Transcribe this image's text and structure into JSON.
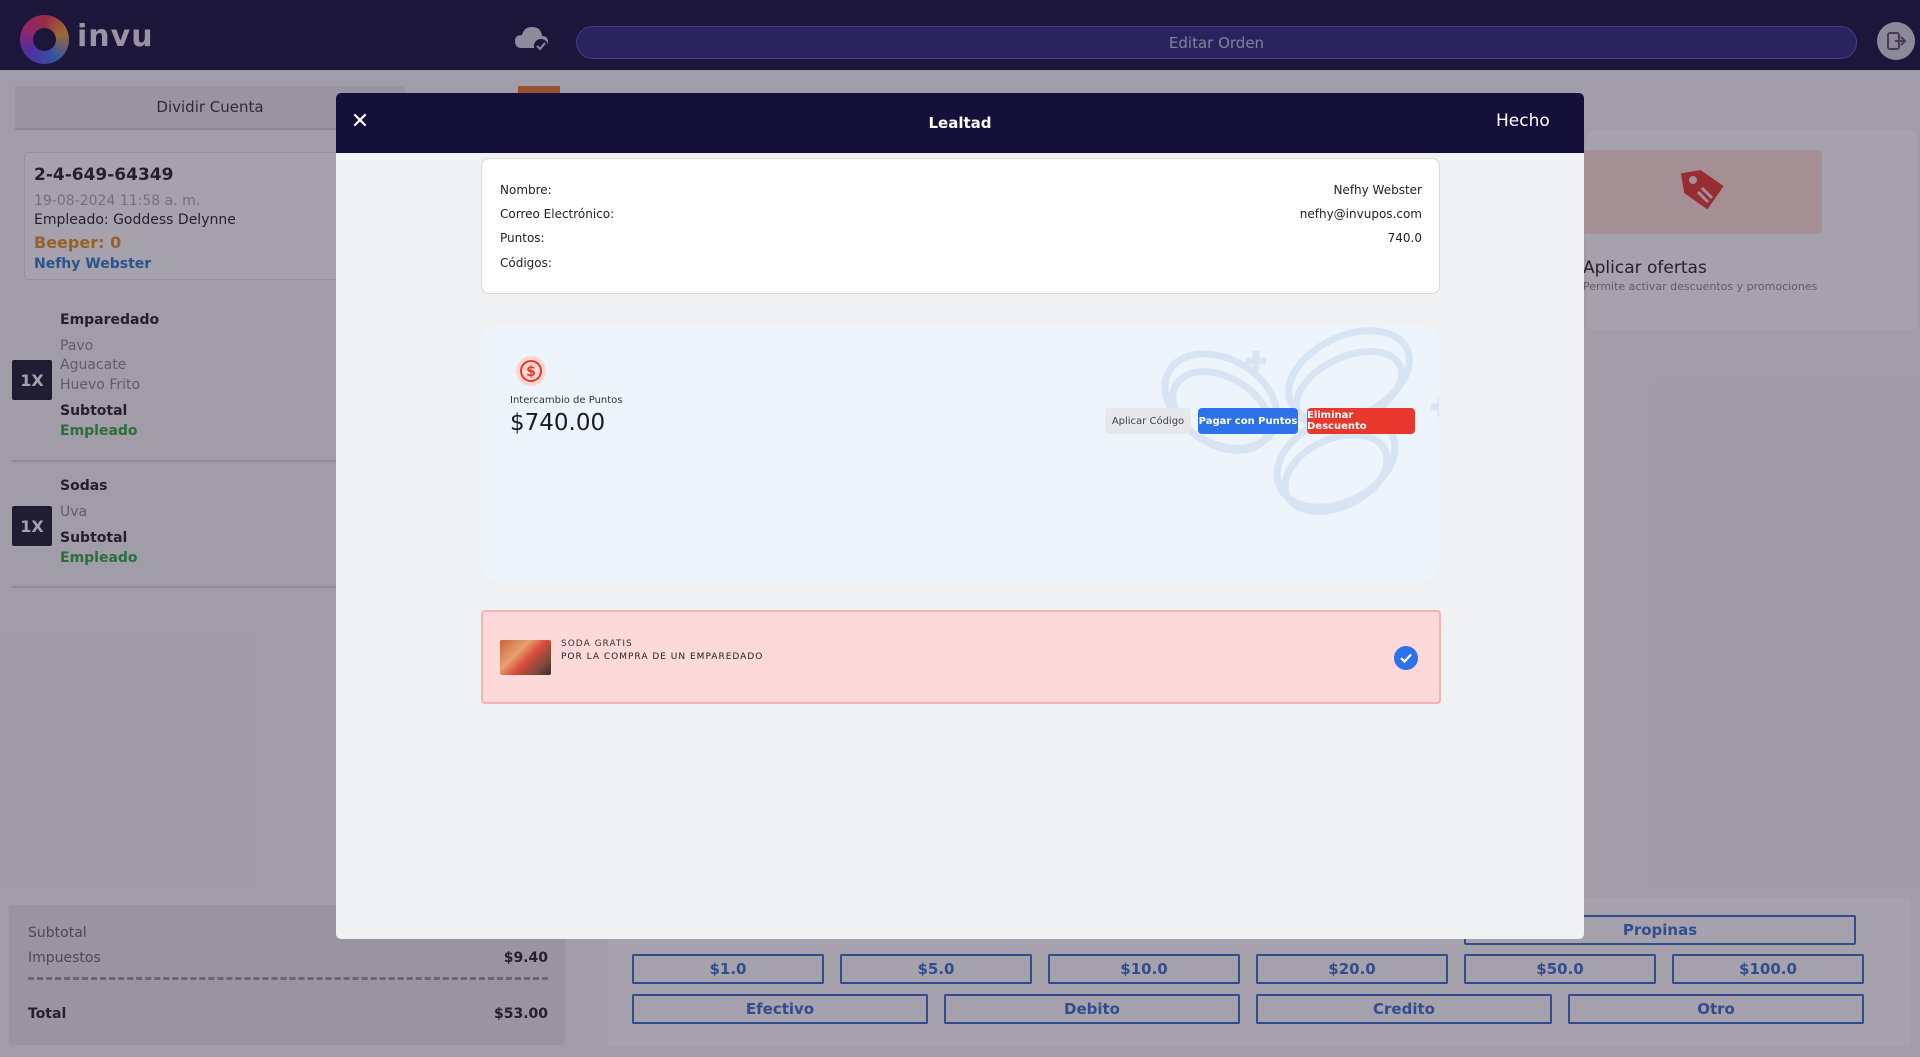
{
  "header": {
    "brand": "invu",
    "edit_order_label": "Editar Orden"
  },
  "left_panel": {
    "split_tab_label": "Dividir Cuenta",
    "order": {
      "number": "2-4-649-64349",
      "date": "19-08-2024 11:58 a. m.",
      "employee_label": "Empleado:",
      "employee_name": "Goddess Delynne",
      "beeper": "Beeper: 0",
      "customer": "Nefhy Webster"
    },
    "items": [
      {
        "qty": "1X",
        "name": "Emparedado",
        "modifiers": [
          "Pavo",
          "Aguacate",
          "Huevo Frito"
        ],
        "subtotal_label": "Subtotal",
        "employee_tag": "Empleado"
      },
      {
        "qty": "1X",
        "name": "Sodas",
        "modifiers": [
          "Uva"
        ],
        "subtotal_label": "Subtotal",
        "employee_tag": "Empleado"
      }
    ],
    "totals": {
      "subtotal_label": "Subtotal",
      "taxes_label": "Impuestos",
      "taxes_value": "$9.40",
      "total_label": "Total",
      "total_value": "$53.00"
    }
  },
  "right_panel": {
    "offers": {
      "title": "Aplicar ofertas",
      "subtitle": "Permite activar descuentos y promociones"
    },
    "tips_label": "Propinas",
    "quick_amounts": [
      "$1.0",
      "$5.0",
      "$10.0",
      "$20.0",
      "$50.0",
      "$100.0"
    ],
    "payment_methods": [
      "Efectivo",
      "Debito",
      "Credito",
      "Otro"
    ]
  },
  "modal": {
    "title": "Lealtad",
    "done_label": "Hecho",
    "customer_info": {
      "name_label": "Nombre:",
      "name_value": "Nefhy Webster",
      "email_label": "Correo Electrónico:",
      "email_value": "nefhy@invupos.com",
      "points_label": "Puntos:",
      "points_value": "740.0",
      "codes_label": "Códigos:"
    },
    "points_exchange": {
      "label": "Intercambio de Puntos",
      "amount": "$740.00",
      "apply_code_label": "Aplicar Código",
      "pay_with_points_label": "Pagar con Puntos",
      "remove_discount_label": "Eliminar Descuento"
    },
    "reward": {
      "title": "SODA GRATIS",
      "description": "POR LA COMPRA DE UN EMPAREDADO",
      "selected": true
    }
  },
  "colors": {
    "header_bg": "#14103a",
    "primary_blue": "#2e72ea",
    "danger_red": "#e8382e",
    "reward_bg": "#fdd9da",
    "beeper_orange": "#e8901a",
    "employee_green": "#2ea83a"
  }
}
